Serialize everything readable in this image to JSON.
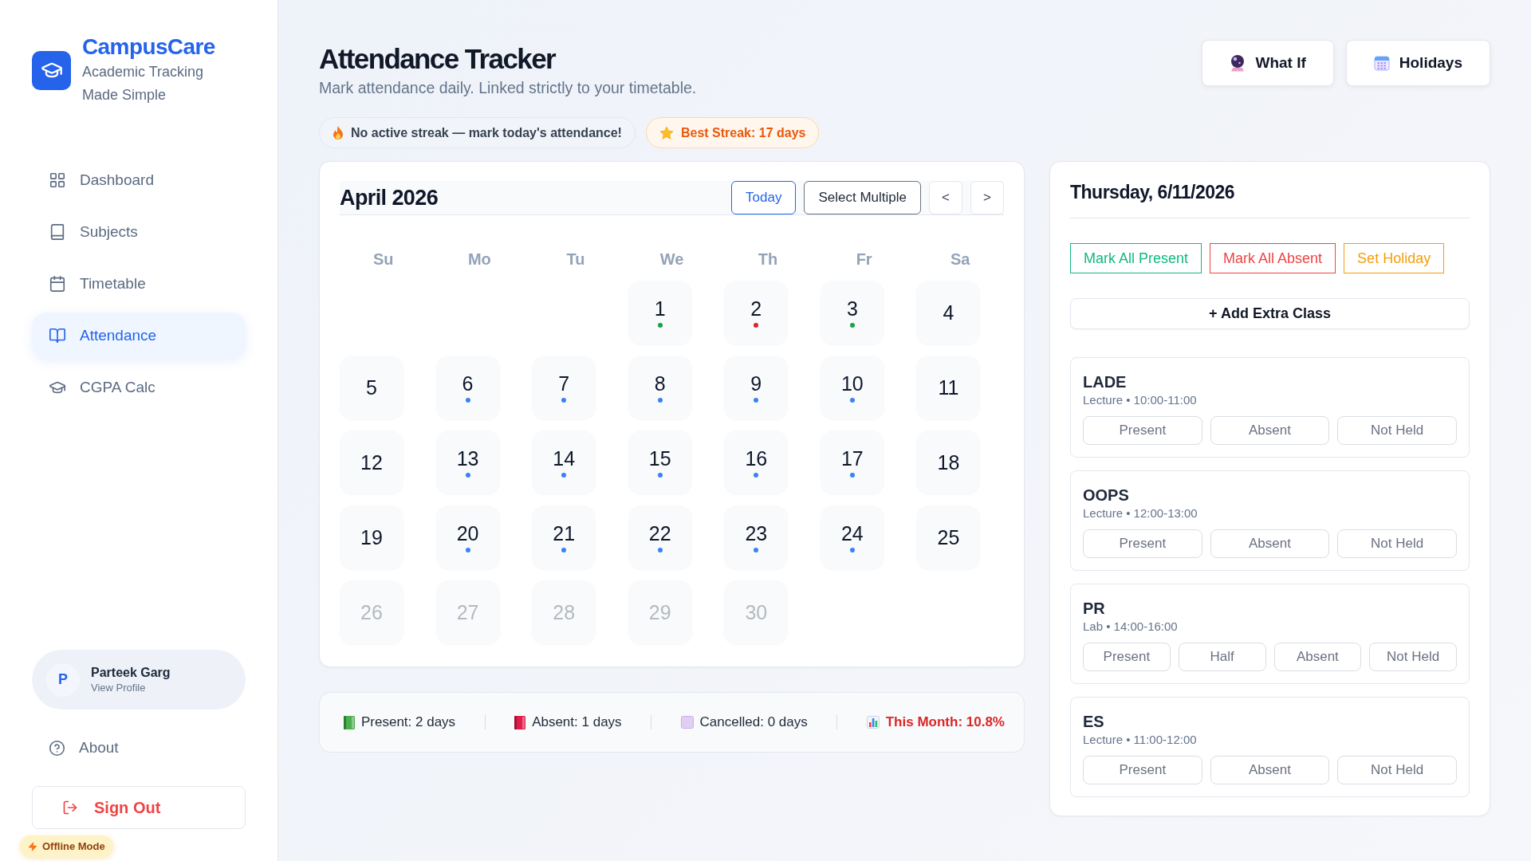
{
  "sidebar": {
    "brand": {
      "name": "CampusCare",
      "tagline": "Academic Tracking Made Simple"
    },
    "nav": [
      {
        "label": "Dashboard",
        "selected": false
      },
      {
        "label": "Subjects",
        "selected": false
      },
      {
        "label": "Timetable",
        "selected": false
      },
      {
        "label": "Attendance",
        "selected": true
      },
      {
        "label": "CGPA Calc",
        "selected": false
      }
    ],
    "profile": {
      "initial": "P",
      "name": "Parteek Garg",
      "link": "View Profile"
    },
    "about": "About",
    "sign_out": "Sign Out",
    "offline_badge": "Offline Mode"
  },
  "header": {
    "title": "Attendance Tracker",
    "subtitle": "Mark attendance daily. Linked strictly to your timetable.",
    "buttons": [
      "What If",
      "Holidays"
    ]
  },
  "streaks": [
    {
      "kind": "current",
      "text": "No active streak — mark today's attendance!"
    },
    {
      "kind": "best",
      "text": "Best Streak: 17 days"
    }
  ],
  "calendar": {
    "month": "April 2026",
    "today": "Today",
    "select_multiple": "Select Multiple",
    "prev": "<",
    "next": ">",
    "weekdays": [
      "Su",
      "Mo",
      "Tu",
      "We",
      "Th",
      "Fr",
      "Sa"
    ],
    "days": [
      {
        "kind": "blank"
      },
      {
        "kind": "blank"
      },
      {
        "kind": "blank"
      },
      {
        "kind": "day",
        "label": "1",
        "disabled": false,
        "color": "#16a34a"
      },
      {
        "kind": "day",
        "label": "2",
        "disabled": false,
        "color": "#dc2626"
      },
      {
        "kind": "day",
        "label": "3",
        "disabled": false,
        "color": "#16a34a"
      },
      {
        "kind": "day",
        "label": "4",
        "disabled": false
      },
      {
        "kind": "day",
        "label": "5",
        "disabled": false
      },
      {
        "kind": "day",
        "label": "6",
        "disabled": false,
        "color": "#3b82f6"
      },
      {
        "kind": "day",
        "label": "7",
        "disabled": false,
        "color": "#3b82f6"
      },
      {
        "kind": "day",
        "label": "8",
        "disabled": false,
        "color": "#3b82f6"
      },
      {
        "kind": "day",
        "label": "9",
        "disabled": false,
        "color": "#3b82f6"
      },
      {
        "kind": "day",
        "label": "10",
        "disabled": false,
        "color": "#3b82f6"
      },
      {
        "kind": "day",
        "label": "11",
        "disabled": false
      },
      {
        "kind": "day",
        "label": "12",
        "disabled": false
      },
      {
        "kind": "day",
        "label": "13",
        "disabled": false,
        "color": "#3b82f6"
      },
      {
        "kind": "day",
        "label": "14",
        "disabled": false,
        "color": "#3b82f6"
      },
      {
        "kind": "day",
        "label": "15",
        "disabled": false,
        "color": "#3b82f6"
      },
      {
        "kind": "day",
        "label": "16",
        "disabled": false,
        "color": "#3b82f6"
      },
      {
        "kind": "day",
        "label": "17",
        "disabled": false,
        "color": "#3b82f6"
      },
      {
        "kind": "day",
        "label": "18",
        "disabled": false
      },
      {
        "kind": "day",
        "label": "19",
        "disabled": false
      },
      {
        "kind": "day",
        "label": "20",
        "disabled": false,
        "color": "#3b82f6"
      },
      {
        "kind": "day",
        "label": "21",
        "disabled": false,
        "color": "#3b82f6"
      },
      {
        "kind": "day",
        "label": "22",
        "disabled": false,
        "color": "#3b82f6"
      },
      {
        "kind": "day",
        "label": "23",
        "disabled": false,
        "color": "#3b82f6"
      },
      {
        "kind": "day",
        "label": "24",
        "disabled": false,
        "color": "#3b82f6"
      },
      {
        "kind": "day",
        "label": "25",
        "disabled": false
      },
      {
        "kind": "day",
        "label": "26",
        "disabled": true
      },
      {
        "kind": "day",
        "label": "27",
        "disabled": true
      },
      {
        "kind": "day",
        "label": "28",
        "disabled": true
      },
      {
        "kind": "day",
        "label": "29",
        "disabled": true
      },
      {
        "kind": "day",
        "label": "30",
        "disabled": true
      }
    ]
  },
  "summary": [
    {
      "kind": "present",
      "text": "Present: 2 days"
    },
    {
      "kind": "absent",
      "text": "Absent: 1 days"
    },
    {
      "kind": "cancelled",
      "text": "Cancelled: 0 days"
    },
    {
      "kind": "month",
      "text": "This Month: 10.8%"
    }
  ],
  "day_panel": {
    "title": "Thursday, 6/11/2026",
    "bulk_actions": [
      {
        "kind": "present",
        "label": "Mark All Present"
      },
      {
        "kind": "absent",
        "label": "Mark All Absent"
      },
      {
        "kind": "holiday",
        "label": "Set Holiday"
      }
    ],
    "add_button": "+ Add Extra Class",
    "classes": [
      {
        "name": "LADE",
        "detail": "Lecture • 10:00-11:00",
        "options": [
          "Present",
          "Absent",
          "Not Held"
        ]
      },
      {
        "name": "OOPS",
        "detail": "Lecture • 12:00-13:00",
        "options": [
          "Present",
          "Absent",
          "Not Held"
        ]
      },
      {
        "name": "PR",
        "detail": "Lab • 14:00-16:00",
        "options": [
          "Present",
          "Half",
          "Absent",
          "Not Held"
        ]
      },
      {
        "name": "ES",
        "detail": "Lecture • 11:00-12:00",
        "options": [
          "Present",
          "Absent",
          "Not Held"
        ]
      }
    ]
  }
}
